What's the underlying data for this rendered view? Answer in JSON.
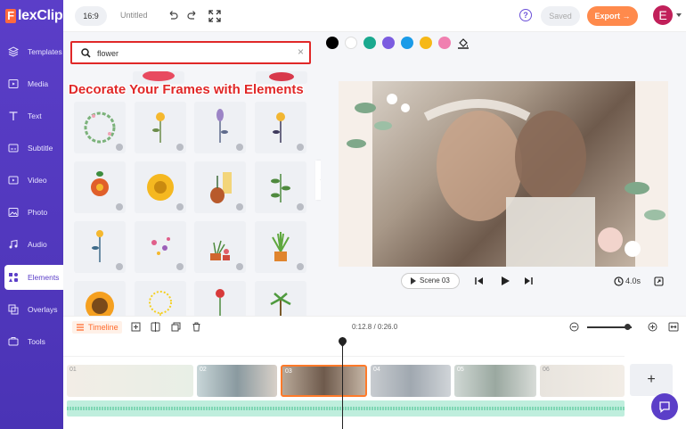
{
  "app": {
    "logo": "FlexClip"
  },
  "sidebar": {
    "items": [
      {
        "label": "Templates",
        "icon": "templates-icon"
      },
      {
        "label": "Media",
        "icon": "media-icon"
      },
      {
        "label": "Text",
        "icon": "text-icon"
      },
      {
        "label": "Subtitle",
        "icon": "subtitle-icon"
      },
      {
        "label": "Video",
        "icon": "video-icon"
      },
      {
        "label": "Photo",
        "icon": "photo-icon"
      },
      {
        "label": "Audio",
        "icon": "audio-icon"
      },
      {
        "label": "Elements",
        "icon": "elements-icon",
        "active": true
      },
      {
        "label": "Overlays",
        "icon": "overlays-icon"
      },
      {
        "label": "Tools",
        "icon": "tools-icon"
      }
    ]
  },
  "topbar": {
    "ratio": "16:9",
    "title": "Untitled",
    "saved_label": "Saved",
    "export_label": "Export →",
    "avatar_letter": "E"
  },
  "panel": {
    "search_value": "flower",
    "clear_icon": "×",
    "banner": "Decorate Your Frames with Elements"
  },
  "canvas": {
    "colors": [
      "#000000",
      "#ffffff",
      "#1aa98f",
      "#7b5ce0",
      "#1a9be8",
      "#f6b817",
      "#f07fb0"
    ],
    "scene_label": "Scene",
    "scene_num": "03",
    "duration": "4.0s"
  },
  "timeline": {
    "label": "Timeline",
    "time": "0:12.8 / 0:26.0",
    "zoom": 0.9,
    "clips": [
      {
        "num": "01"
      },
      {
        "num": "02"
      },
      {
        "num": "03"
      },
      {
        "num": "04"
      },
      {
        "num": "05"
      },
      {
        "num": "06"
      }
    ],
    "add_label": "+"
  },
  "accent": "#5b3ec8",
  "highlight": "#e02828",
  "export_color": "#ff8a4c"
}
